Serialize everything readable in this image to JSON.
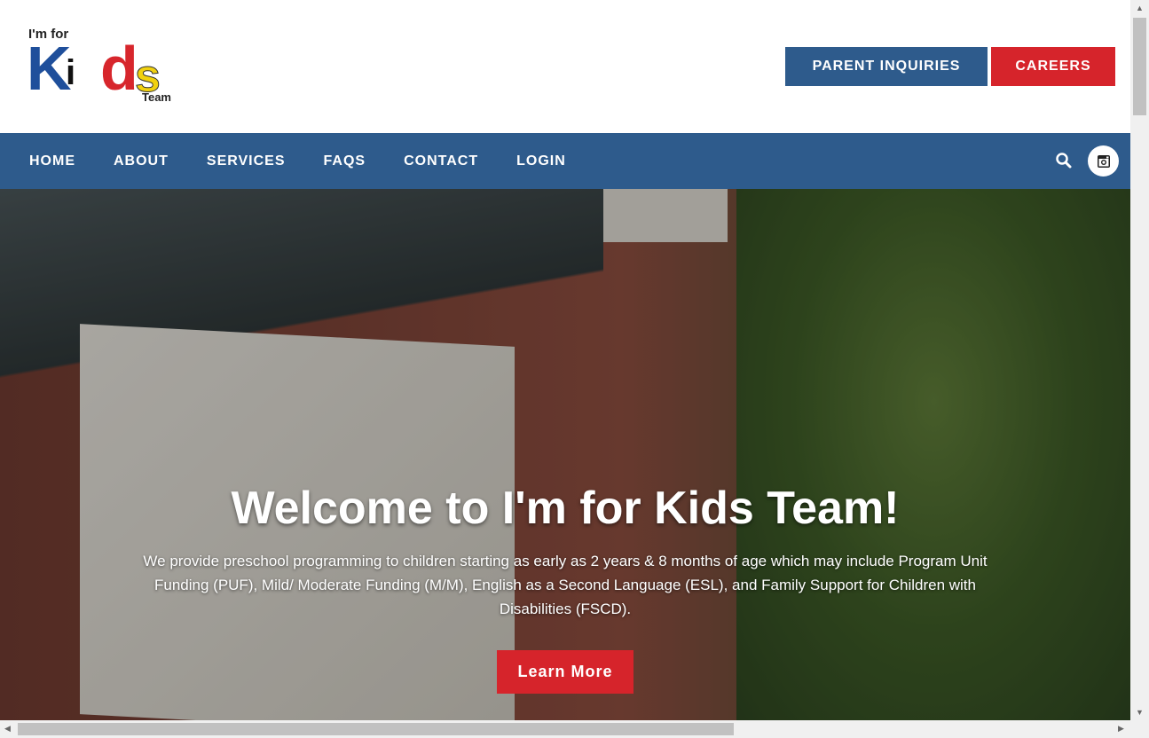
{
  "header": {
    "logo_text": "I'm for Kids Team",
    "parent_inquiries": "PARENT INQUIRIES",
    "careers": "CAREERS"
  },
  "nav": {
    "items": [
      "HOME",
      "ABOUT",
      "SERVICES",
      "FAQS",
      "CONTACT",
      "LOGIN"
    ],
    "search_icon": "search-icon",
    "social_icon": "instagram-icon"
  },
  "hero": {
    "title": "Welcome to I'm for Kids Team!",
    "text": "We provide preschool programming to children starting as early as 2 years & 8 months of age which may include Program Unit Funding (PUF), Mild/ Moderate Funding (M/M), English as a Second Language (ESL), and Family Support for Children with Disabilities (FSCD).",
    "button": "Learn More"
  },
  "colors": {
    "nav": "#2e5b8c",
    "accent": "#d6242b"
  }
}
